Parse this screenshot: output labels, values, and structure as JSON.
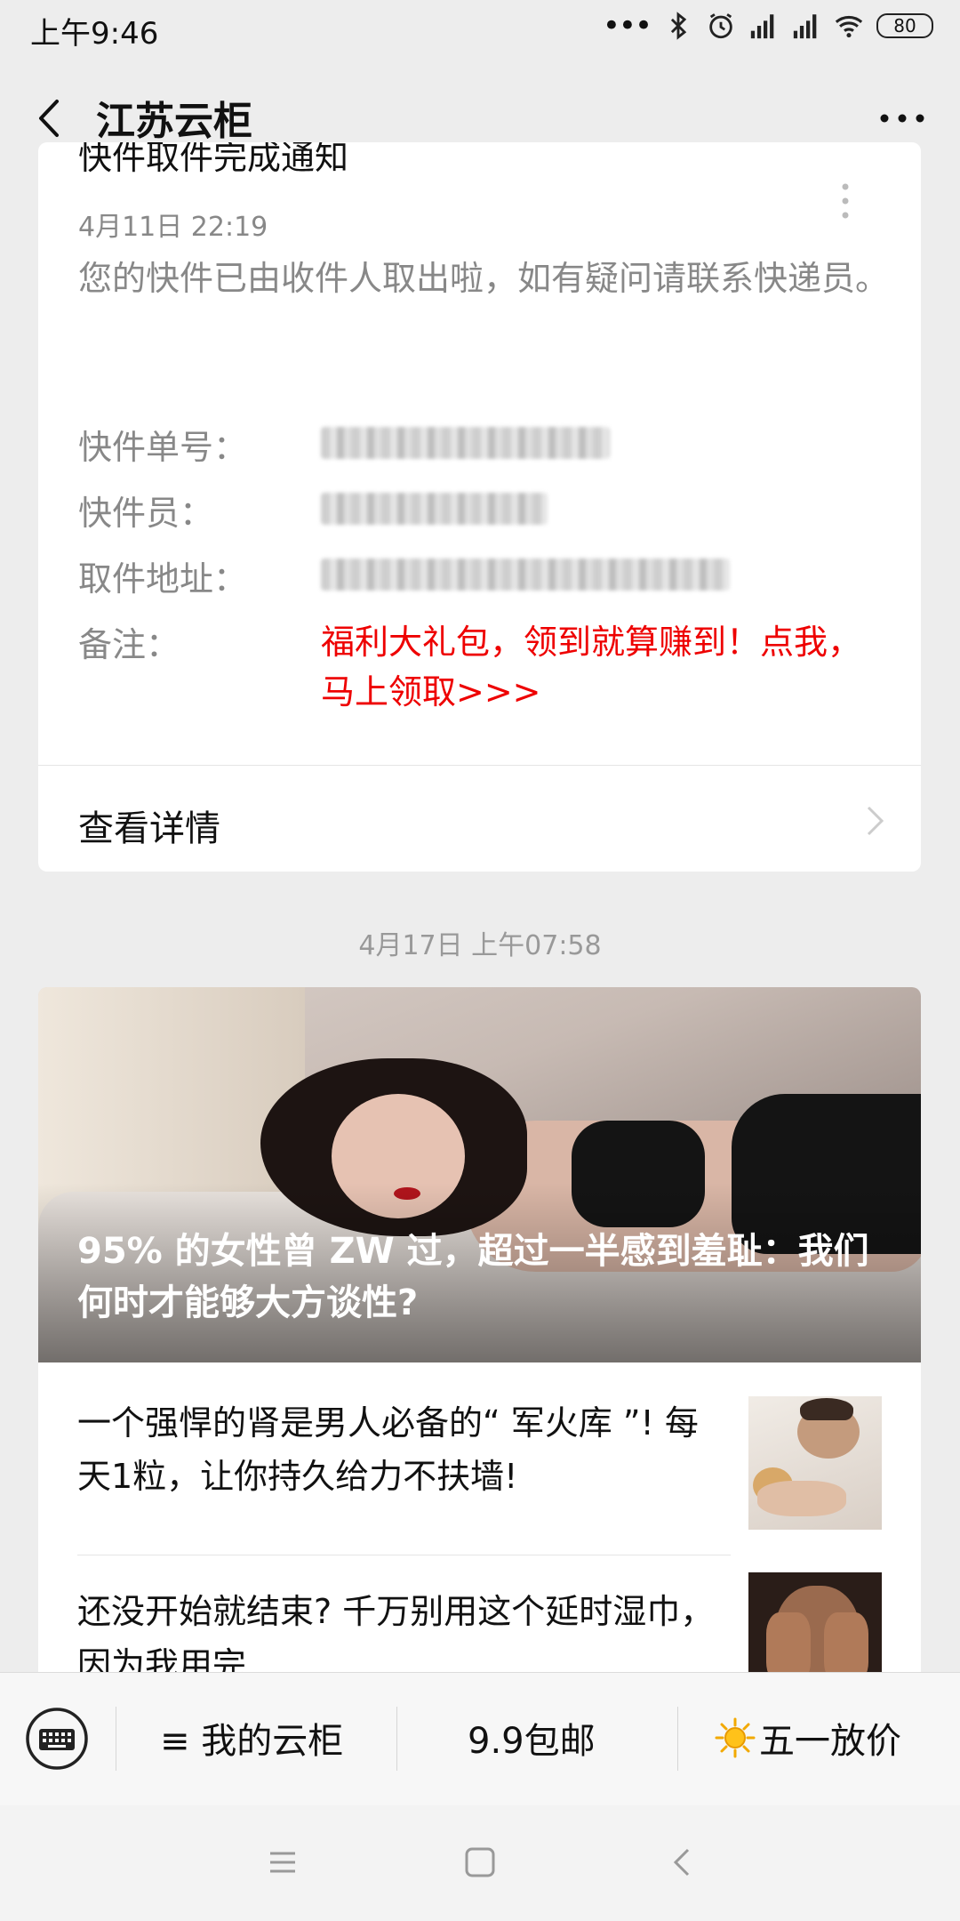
{
  "status_bar": {
    "time": "上午9:46",
    "signal_dots": "•••",
    "battery": "80"
  },
  "header": {
    "title": "江苏云柜"
  },
  "notification": {
    "title_partial": "快件取件完成通知",
    "date": "4月11日  22:19",
    "body": "您的快件已由收件人取出啦，如有疑问请联系快递员。",
    "fields": {
      "tracking_label": "快件单号：",
      "courier_label": "快件员：",
      "address_label": "取件地址：",
      "remark_label": "备注："
    },
    "remark_value": "福利大礼包，领到就算赚到！点我，马上领取>>>",
    "details_label": "查看详情"
  },
  "timestamp": "4月17日 上午07:58",
  "article": {
    "hero_caption": "95% 的女性曾 ZW 过，超过一半感到羞耻：我们何时才能够大方谈性?",
    "items": [
      {
        "text": "一个强悍的肾是男人必备的“ 军火库 ”! 每天1粒，让你持久给力不扶墙!"
      },
      {
        "text": "还没开始就结束? 千万别用这个延时湿巾，因为我用完..."
      }
    ]
  },
  "menu": {
    "item1": "≡ 我的云柜",
    "item2": "9.9包邮",
    "item3": "五一放价"
  },
  "colors": {
    "accent_red": "#e00000",
    "background": "#ededed"
  }
}
